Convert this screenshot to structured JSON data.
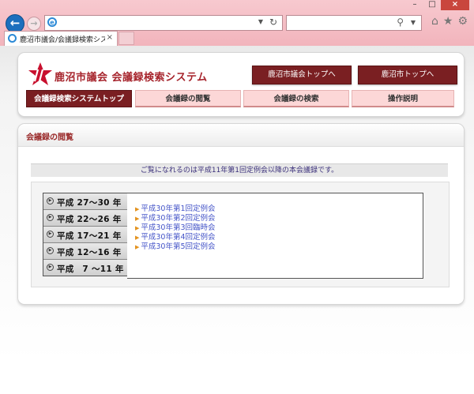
{
  "browser": {
    "tab_title": "鹿沼市議会/会議録検索シス...",
    "tab_close": "×",
    "window_controls": [
      "–",
      "□",
      "×"
    ]
  },
  "site": {
    "title": "鹿沼市議会 会議録検索システム",
    "top_buttons": [
      "鹿沼市議会トップへ",
      "鹿沼市トップへ"
    ],
    "nav_tabs": [
      {
        "label": "会議録検索システムトップ",
        "active": true
      },
      {
        "label": "会議録の閲覧",
        "active": false
      },
      {
        "label": "会議録の検索",
        "active": false
      },
      {
        "label": "操作説明",
        "active": false
      }
    ],
    "brand_color": "#7a1f22"
  },
  "content": {
    "heading": "会議録の閲覧",
    "notice": "ご覧になれるのは平成11年第1回定例会以降の本会議録です。",
    "year_ranges": [
      "平成 27～30 年",
      "平成 22～26 年",
      "平成 17～21 年",
      "平成 12～16 年",
      "平成　7 ～11 年"
    ],
    "sessions": [
      "平成30年第1回定例会",
      "平成30年第2回定例会",
      "平成30年第3回臨時会",
      "平成30年第4回定例会",
      "平成30年第5回定例会"
    ]
  }
}
